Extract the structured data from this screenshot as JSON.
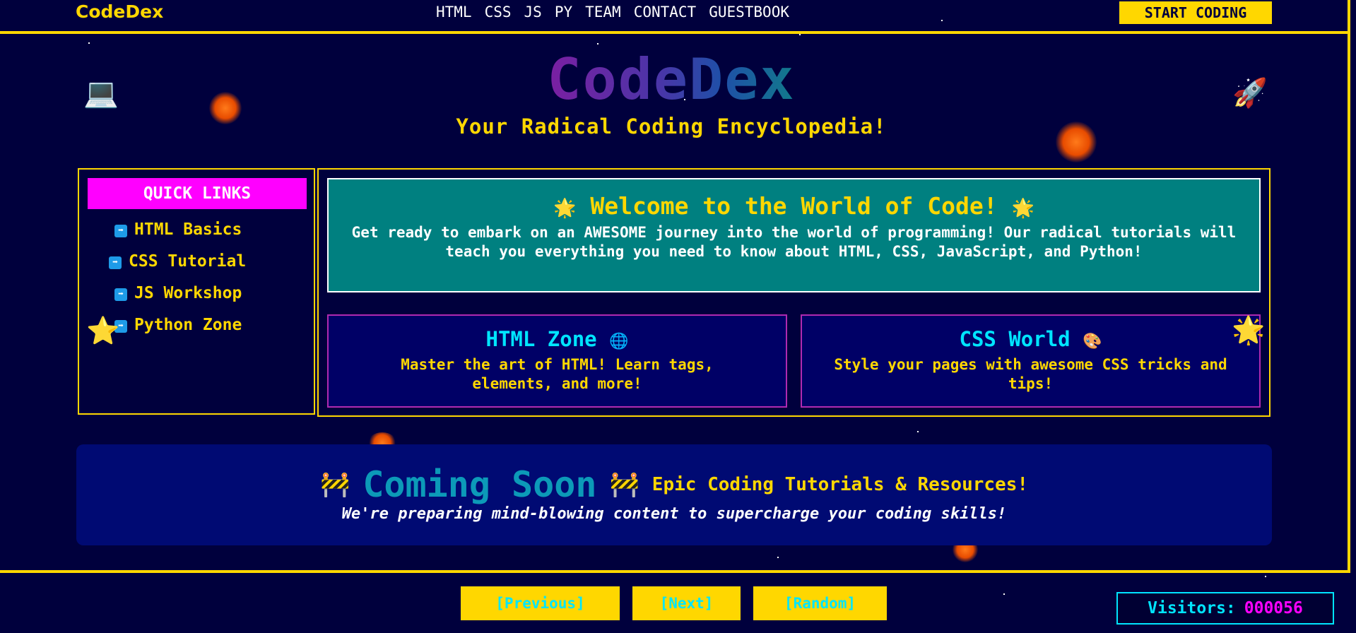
{
  "brand": "CodeDex",
  "nav": {
    "links": [
      "HTML",
      "CSS",
      "JS",
      "PY",
      "TEAM",
      "CONTACT",
      "GUESTBOOK"
    ],
    "cta": "START CODING"
  },
  "hero": {
    "title": "CodeDex",
    "subtitle": "Your Radical Coding Encyclopedia!",
    "left_icon": "💻",
    "right_icon": "🚀"
  },
  "sidebar": {
    "heading": "QUICK LINKS",
    "items": [
      "HTML Basics",
      "CSS Tutorial",
      "JS Workshop",
      "Python Zone"
    ],
    "arrow": "➡",
    "star": "⭐"
  },
  "welcome": {
    "title": "Welcome to the World of Code!",
    "title_icon": "🌟",
    "body": "Get ready to embark on an AWESOME journey into the world of programming! Our radical tutorials will teach you everything you need to know about HTML, CSS, JavaScript, and Python!"
  },
  "zones": [
    {
      "title": "HTML Zone",
      "icon": "🌐",
      "body": "Master the art of HTML! Learn tags, elements, and more!"
    },
    {
      "title": "CSS World",
      "icon": "🎨",
      "body": "Style your pages with awesome CSS tricks and tips!"
    }
  ],
  "zone_star": "🌟",
  "coming_soon": {
    "title": "Coming Soon",
    "icon": "🚧",
    "tagline": "Epic Coding Tutorials & Resources!",
    "subtitle": "We're preparing mind-blowing content to supercharge your coding skills!"
  },
  "footer": {
    "prev": "[Previous]",
    "next": "[Next]",
    "random": "[Random]",
    "visitors_label": "Visitors:",
    "visitors_count": "000056"
  }
}
